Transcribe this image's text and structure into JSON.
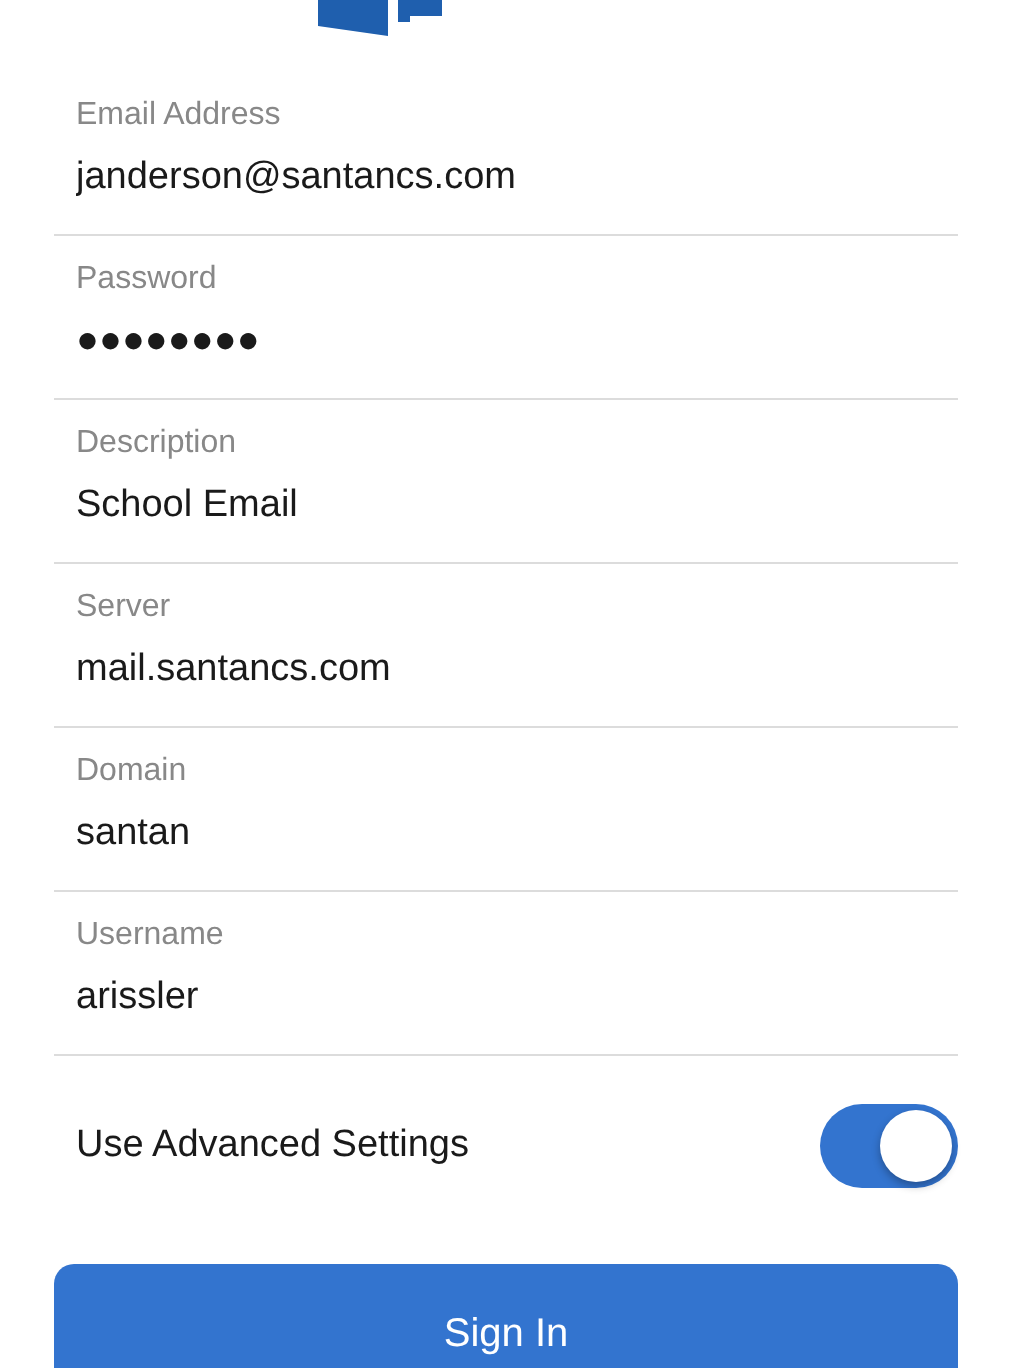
{
  "fields": [
    {
      "label": "Email Address",
      "value": "janderson@santancs.com"
    },
    {
      "label": "Password",
      "value": "●●●●●●●●"
    },
    {
      "label": "Description",
      "value": "School Email"
    },
    {
      "label": "Server",
      "value": "mail.santancs.com"
    },
    {
      "label": "Domain",
      "value": "santan"
    },
    {
      "label": "Username",
      "value": "arissler"
    }
  ],
  "advanced": {
    "label": "Use Advanced Settings",
    "on": true
  },
  "sign_in": {
    "label": "Sign In"
  }
}
